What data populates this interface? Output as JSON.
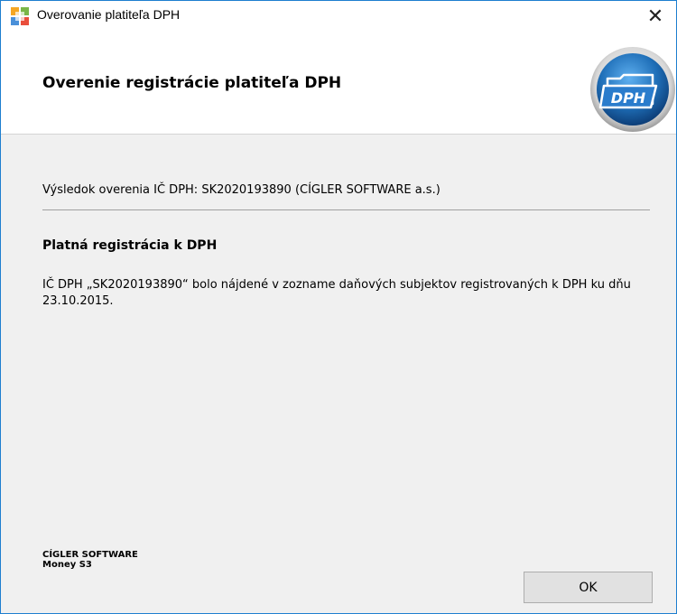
{
  "window": {
    "title": "Overovanie platiteľa DPH",
    "close_symbol": "✕"
  },
  "header": {
    "title": "Overenie registrácie platiteľa DPH",
    "logo_icon": "dph-folder-icon",
    "logo_text": "DPH"
  },
  "content": {
    "result_line": "Výsledok overenia IČ DPH:  SK2020193890 (CÍGLER SOFTWARE a.s.)",
    "status_heading": "Platná registrácia k DPH",
    "message": "IČ DPH „SK2020193890“ bolo nájdené v zozname daňových subjektov registrovaných k DPH ku dňu 23.10.2015."
  },
  "footer": {
    "company": "CÍGLER SOFTWARE",
    "product": "Money S3",
    "ok_label": "OK"
  },
  "colors": {
    "window_border": "#1e7fcf",
    "header_bg": "#ffffff",
    "body_bg": "#f0f0f0",
    "logo_blue": "#1f6fb8"
  }
}
